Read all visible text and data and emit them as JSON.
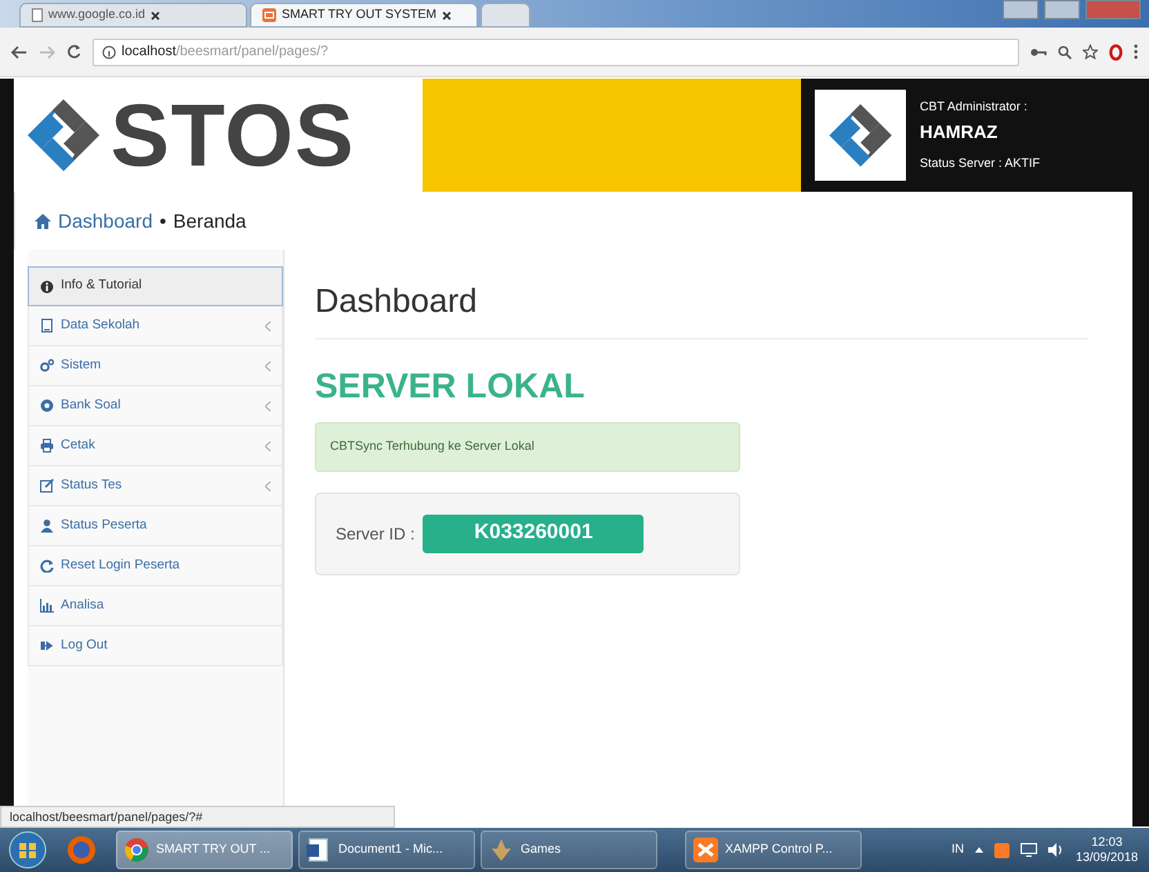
{
  "browser": {
    "tabs": [
      {
        "label": "www.google.co.id",
        "selected": false
      },
      {
        "label": "SMART TRY OUT SYSTEM",
        "selected": true
      }
    ],
    "url_host": "localhost",
    "url_path": "/beesmart/panel/pages/?"
  },
  "header": {
    "logo_text": "STOS",
    "role": "CBT Administrator :",
    "user": "HAMRAZ",
    "server_status": "Status Server : AKTIF"
  },
  "breadcrumb": {
    "link": "Dashboard",
    "separator": "•",
    "current": "Beranda"
  },
  "sidebar": {
    "items": [
      {
        "label": "Info & Tutorial",
        "selected": true,
        "submenu": false
      },
      {
        "label": "Data Sekolah",
        "selected": false,
        "submenu": true
      },
      {
        "label": "Sistem",
        "selected": false,
        "submenu": true
      },
      {
        "label": "Bank Soal",
        "selected": false,
        "submenu": true
      },
      {
        "label": "Cetak",
        "selected": false,
        "submenu": true
      },
      {
        "label": "Status Tes",
        "selected": false,
        "submenu": true
      },
      {
        "label": "Status Peserta",
        "selected": false,
        "submenu": false
      },
      {
        "label": "Reset Login Peserta",
        "selected": false,
        "submenu": false
      },
      {
        "label": "Analisa",
        "selected": false,
        "submenu": false
      },
      {
        "label": "Log Out",
        "selected": false,
        "submenu": false
      }
    ]
  },
  "main": {
    "title": "Dashboard",
    "server_heading": "SERVER LOKAL",
    "alert": "CBTSync Terhubung ke Server Lokal",
    "server_id_label": "Server ID :",
    "server_id": "K033260001"
  },
  "status_url": "localhost/beesmart/panel/pages/?#",
  "taskbar": {
    "items": [
      {
        "label": "SMART TRY OUT ...",
        "selected": true
      },
      {
        "label": "Document1 - Mic...",
        "selected": false
      },
      {
        "label": "Games",
        "selected": false
      },
      {
        "label": "XAMPP Control P...",
        "selected": false
      }
    ],
    "language": "IN",
    "time": "12:03",
    "date": "13/09/2018"
  }
}
